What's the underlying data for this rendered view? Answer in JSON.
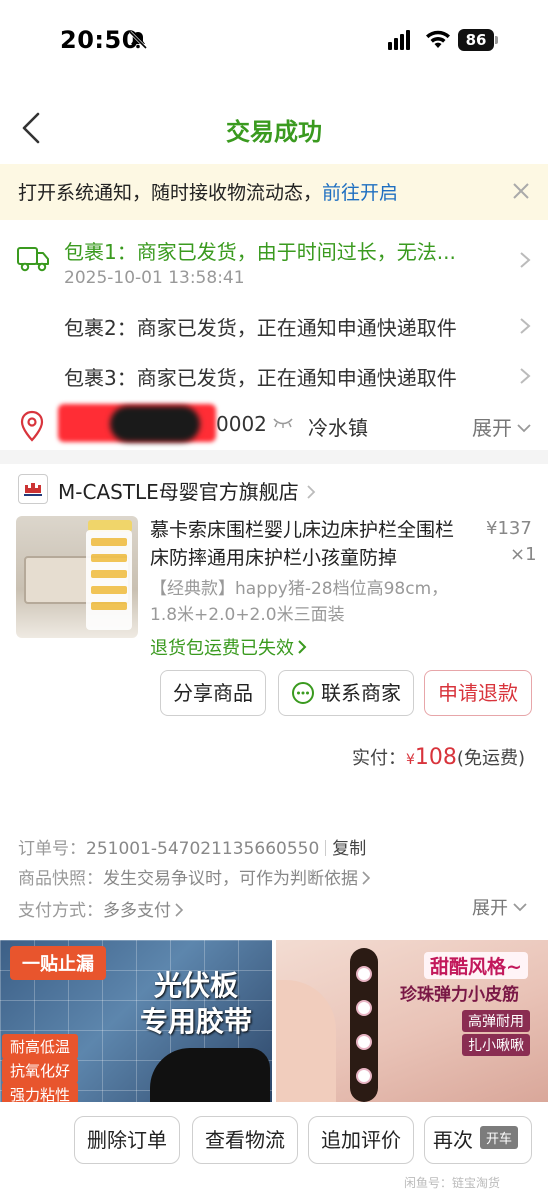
{
  "status_bar": {
    "time": "20:50",
    "battery": "86"
  },
  "nav": {
    "title": "交易成功"
  },
  "notice": {
    "text": "打开系统通知，随时接收物流动态，",
    "link": "前往开启"
  },
  "packages": [
    {
      "title": "包裹1：商家已发货，由于时间过长，无法...",
      "time": "2025-10-01 13:58:41"
    },
    {
      "title": "包裹2：商家已发货，正在通知申通快递取件"
    },
    {
      "title": "包裹3：商家已发货，正在通知申通快递取件"
    }
  ],
  "address": {
    "phone_tail": "0002",
    "town": "冷水镇",
    "expand": "展开"
  },
  "shop": {
    "name": "M-CASTLE母婴官方旗舰店"
  },
  "product": {
    "title": "慕卡索床围栏婴儿床边床护栏全围栏床防摔通用床护栏小孩童防掉",
    "price": "¥137",
    "qty": "×1",
    "spec": "【经典款】happy猪-28档位高98cm，1.8米+2.0+2.0米三面装",
    "return_note": "退货包运费已失效"
  },
  "actions": {
    "share": "分享商品",
    "contact": "联系商家",
    "refund": "申请退款"
  },
  "payment": {
    "label": "实付：",
    "currency": "¥",
    "amount": "108",
    "note": "(免运费)"
  },
  "order_info": {
    "order_no_label": "订单号：",
    "order_no": "251001-547021135660550",
    "copy": "复制",
    "snapshot_label": "商品快照：",
    "snapshot_value": "发生交易争议时，可作为判断依据",
    "pay_label": "支付方式：",
    "pay_value": "多多支付",
    "expand": "展开"
  },
  "ads": [
    {
      "tag": "一贴止漏",
      "headline_1": "光伏板",
      "headline_2": "专用胶带",
      "chips": [
        "耐高低温",
        "抗氧化好",
        "强力粘性"
      ]
    },
    {
      "title": "甜酷风格~",
      "subtitle": "珍珠弹力小皮筋",
      "chips": [
        "高弹耐用",
        "扎小啾啾"
      ]
    }
  ],
  "bottom_bar": {
    "delete": "删除订单",
    "logistics": "查看物流",
    "review": "追加评价",
    "rebuy": "再次",
    "badge": "开车",
    "watermark": "闲鱼号：链宝淘货"
  },
  "colors": {
    "accent_green": "#3a9a1f",
    "price_red": "#d8343c",
    "link_blue": "#1f6fc1",
    "notice_bg": "#fdf8e3"
  }
}
